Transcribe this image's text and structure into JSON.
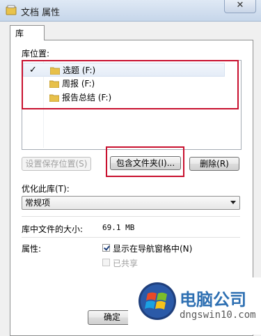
{
  "window": {
    "title": "文档 属性",
    "close_label": "✕"
  },
  "tab": {
    "label": "库"
  },
  "library_locations": {
    "label": "库位置:",
    "items": [
      {
        "name": "选题 (F:)",
        "default": true
      },
      {
        "name": "周报 (F:)",
        "default": false
      },
      {
        "name": "报告总结 (F:)",
        "default": false
      }
    ],
    "default_mark": "✓"
  },
  "buttons": {
    "set_save_location": "设置保存位置(S)",
    "include_folder": "包含文件夹(I)...",
    "remove": "删除(R)",
    "ok": "确定"
  },
  "optimize": {
    "label": "优化此库(T):",
    "value": "常规项"
  },
  "size": {
    "label": "库中文件的大小:",
    "value": "69.1 MB"
  },
  "attributes": {
    "label": "属性:",
    "show_in_nav": {
      "label": "显示在导航窗格中(N)",
      "checked": true
    },
    "shared": {
      "label": "已共享",
      "checked": false,
      "disabled": true
    }
  },
  "watermark": {
    "text": "电脑公司",
    "url": "dngswin10.com"
  },
  "colors": {
    "highlight_box": "#c8102e",
    "titlebar": "#c6d6ea"
  }
}
